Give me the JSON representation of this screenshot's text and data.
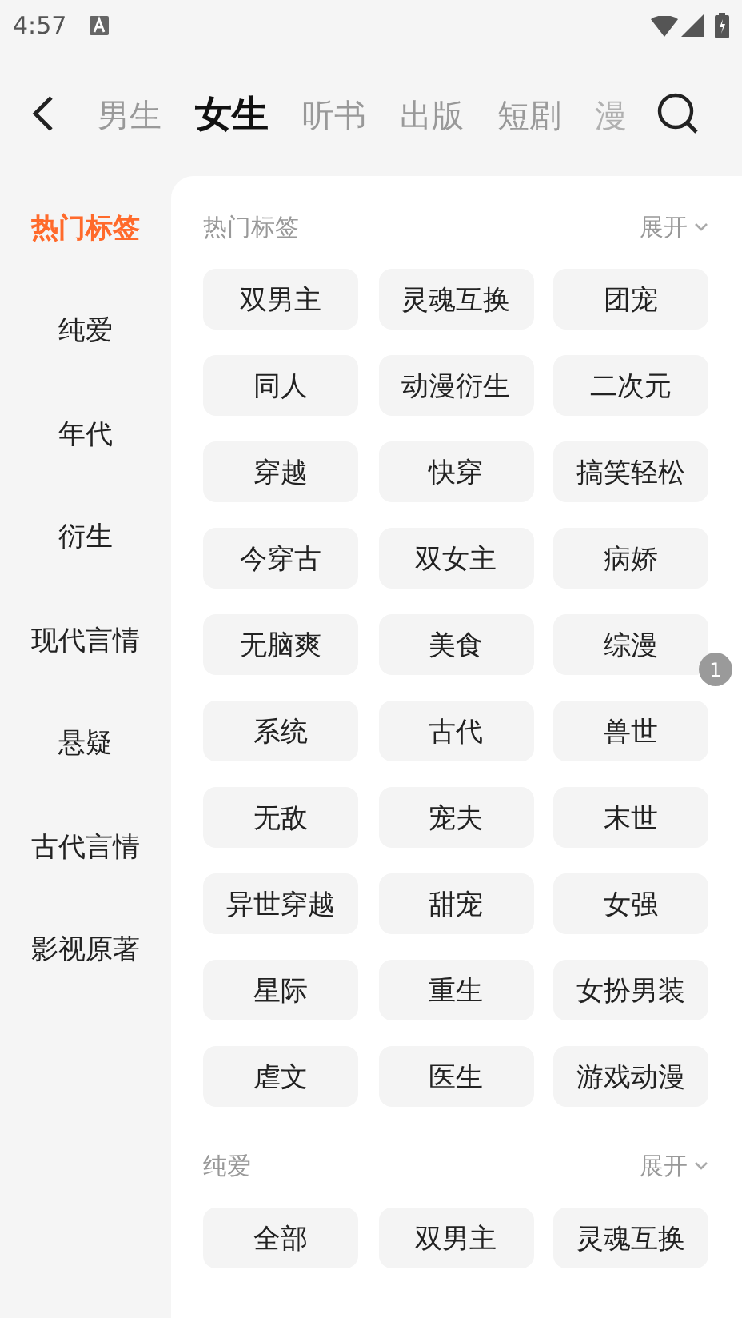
{
  "status_bar": {
    "time": "4:57"
  },
  "tabs": [
    {
      "label": "男生",
      "selected": false
    },
    {
      "label": "女生",
      "selected": true
    },
    {
      "label": "听书",
      "selected": false
    },
    {
      "label": "出版",
      "selected": false
    },
    {
      "label": "短剧",
      "selected": false
    },
    {
      "label": "漫",
      "selected": false
    }
  ],
  "sidebar": {
    "items": [
      {
        "label": "热门标签",
        "selected": true
      },
      {
        "label": "纯爱",
        "selected": false
      },
      {
        "label": "年代",
        "selected": false
      },
      {
        "label": "衍生",
        "selected": false
      },
      {
        "label": "现代言情",
        "selected": false
      },
      {
        "label": "悬疑",
        "selected": false
      },
      {
        "label": "古代言情",
        "selected": false
      },
      {
        "label": "影视原著",
        "selected": false
      }
    ]
  },
  "sections": [
    {
      "title": "热门标签",
      "toggle": "展开",
      "tags": [
        "双男主",
        "灵魂互换",
        "团宠",
        "同人",
        "动漫衍生",
        "二次元",
        "穿越",
        "快穿",
        "搞笑轻松",
        "今穿古",
        "双女主",
        "病娇",
        "无脑爽",
        "美食",
        "综漫",
        "系统",
        "古代",
        "兽世",
        "无敌",
        "宠夫",
        "末世",
        "异世穿越",
        "甜宠",
        "女强",
        "星际",
        "重生",
        "女扮男装",
        "虐文",
        "医生",
        "游戏动漫"
      ]
    },
    {
      "title": "纯爱",
      "toggle": "展开",
      "tags": [
        "全部",
        "双男主",
        "灵魂互换"
      ]
    }
  ],
  "badge": "1"
}
